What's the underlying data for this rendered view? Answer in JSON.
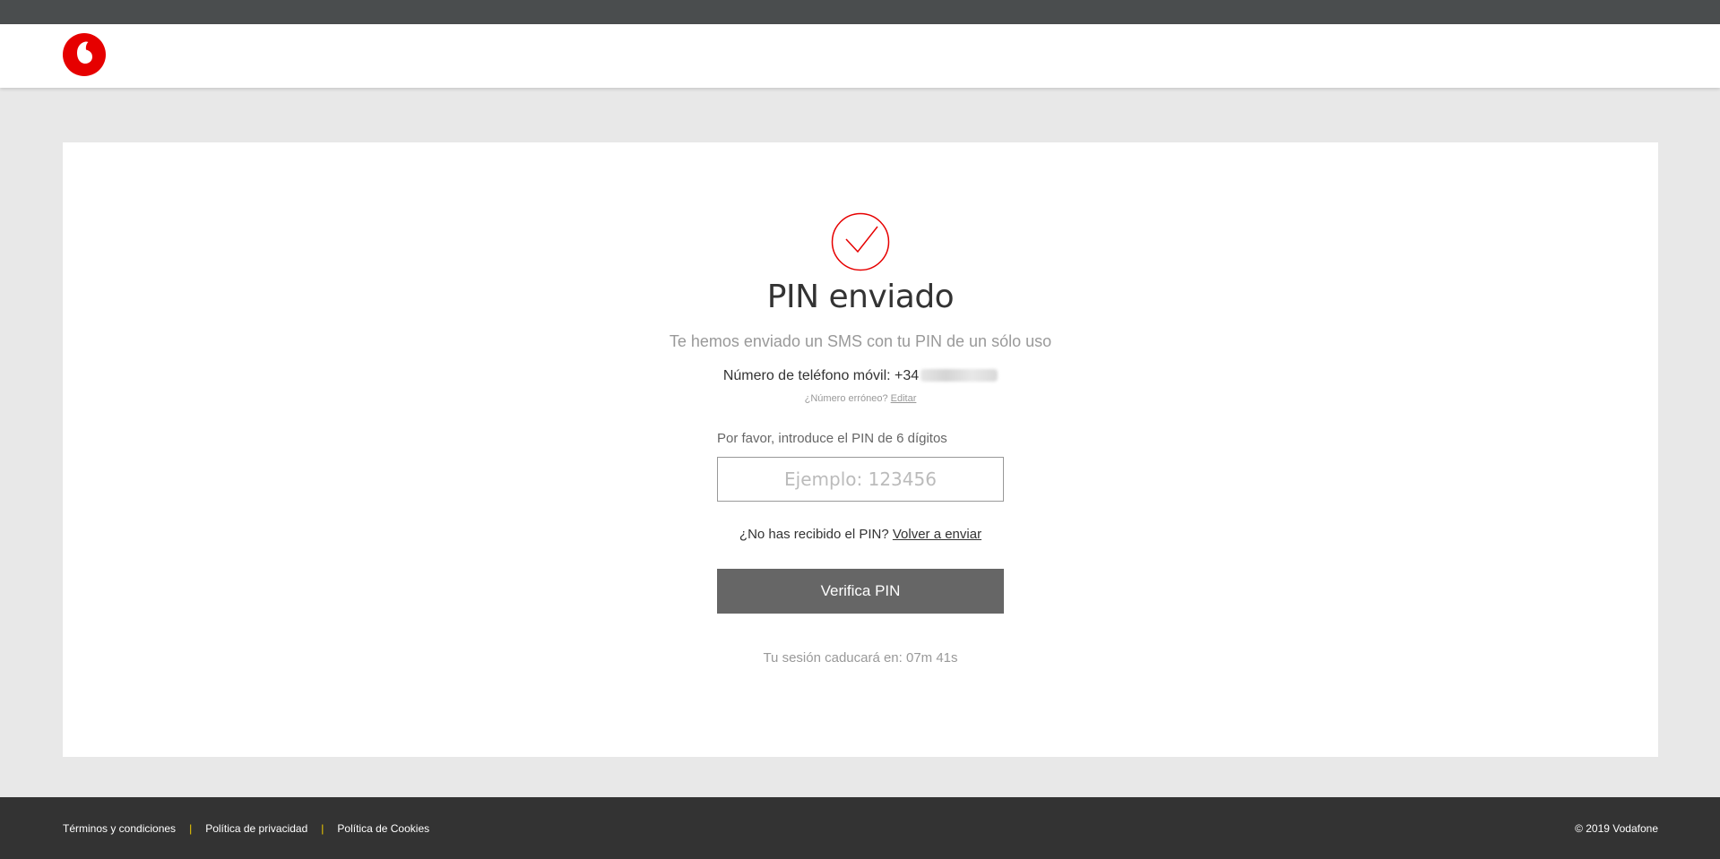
{
  "brand": {
    "logo_icon": "vodafone-logo-icon",
    "accent_color": "#e60000"
  },
  "main": {
    "status_icon": "check-circle-icon",
    "title": "PIN enviado",
    "subtitle": "Te hemos enviado un SMS con tu PIN de un sólo uso",
    "phone_label": "Número de teléfono móvil:",
    "phone_prefix": "+34",
    "wrong_number_text": "¿Número erróneo?",
    "edit_link": "Editar",
    "pin_label": "Por favor, introduce el PIN de 6 dígitos",
    "pin_placeholder": "Ejemplo: 123456",
    "pin_value": "",
    "not_received_text": "¿No has recibido el PIN?",
    "resend_link": "Volver a enviar",
    "verify_button": "Verifica PIN",
    "session_text": "Tu sesión caducará en: 07m 41s"
  },
  "footer": {
    "links": [
      "Términos y condiciones",
      "Política de privacidad",
      "Política de Cookies"
    ],
    "separator": "|",
    "copyright": "© 2019 Vodafone"
  }
}
